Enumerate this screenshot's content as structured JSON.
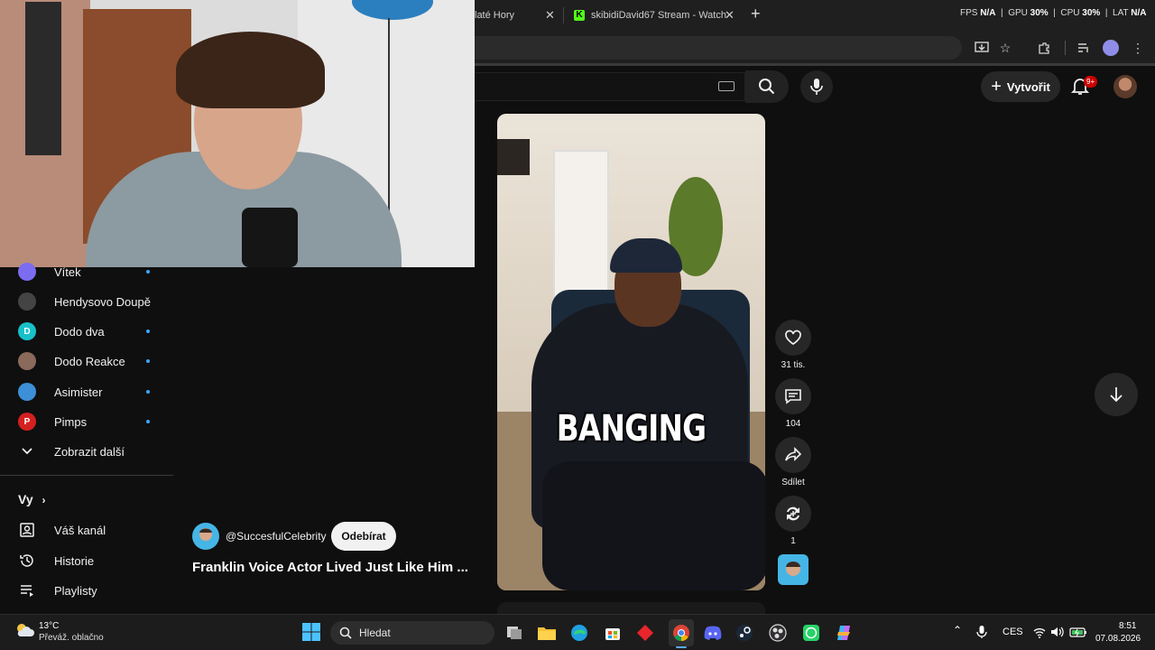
{
  "browser": {
    "tabs": [
      {
        "title": "laté Hory"
      },
      {
        "title": "skibidiDavid67 Stream - Watch"
      }
    ],
    "overlay_stats": {
      "fps_label": "FPS",
      "fps_value": "N/A",
      "gpu_label": "GPU",
      "gpu_value": "30%",
      "cpu_label": "CPU",
      "cpu_value": "30%",
      "lat_label": "LAT",
      "lat_value": "N/A"
    }
  },
  "youtube": {
    "create_label": "Vytvořit",
    "notification_badge": "9+"
  },
  "sidebar": {
    "subscriptions": [
      {
        "label": "Vítek",
        "new": true,
        "color": "#7b6cf0",
        "initial": ""
      },
      {
        "label": "Hendysovo Doupě",
        "new": false,
        "color": "#444444",
        "initial": ""
      },
      {
        "label": "Dodo dva",
        "new": true,
        "color": "#18c1c9",
        "initial": "D"
      },
      {
        "label": "Dodo Reakce",
        "new": true,
        "color": "#8a6a5a",
        "initial": ""
      },
      {
        "label": "Asimister",
        "new": true,
        "color": "#3d8fd8",
        "initial": ""
      },
      {
        "label": "Pimps",
        "new": true,
        "color": "#d42020",
        "initial": "P"
      }
    ],
    "show_more_label": "Zobrazit další",
    "you_section": "Vy",
    "you_items": [
      {
        "label": "Váš kanál",
        "icon": "channel-icon"
      },
      {
        "label": "Historie",
        "icon": "history-icon"
      },
      {
        "label": "Playlisty",
        "icon": "playlist-icon"
      }
    ]
  },
  "short": {
    "caption": "BANGING",
    "channel_handle": "@SuccesfulCelebrity",
    "subscribe_label": "Odebírat",
    "title": "Franklin Voice Actor Lived Just Like Him ...",
    "actions": {
      "likes": "31 tis.",
      "comments": "104",
      "share_label": "Sdílet",
      "remix_count": "1"
    }
  },
  "taskbar": {
    "weather_temp": "13°C",
    "weather_desc": "Převáž. oblačno",
    "search_placeholder": "Hledat",
    "language": "CES",
    "time": "8:51",
    "date": "07.08.2026"
  }
}
